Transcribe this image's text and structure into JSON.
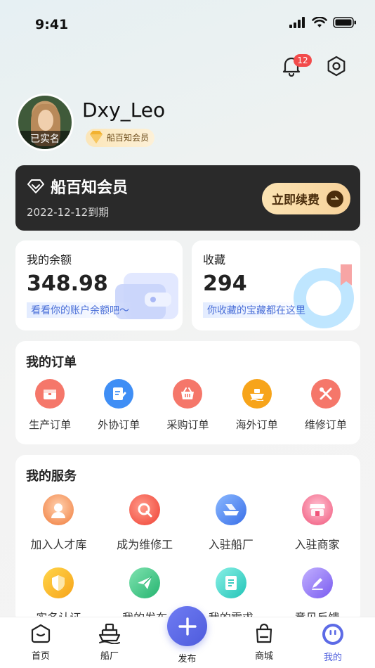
{
  "status_bar": {
    "time": "9:41"
  },
  "header": {
    "notification_count": "12"
  },
  "profile": {
    "username": "Dxy_Leo",
    "verified_label": "已实名",
    "member_badge": "船百知会员"
  },
  "vip_card": {
    "title": "船百知会员",
    "expiry": "2022-12-12到期",
    "renew_label": "立即续费"
  },
  "balance": {
    "title": "我的余额",
    "value": "348.98",
    "hint": "看看你的账户余额吧～"
  },
  "favorites": {
    "title": "收藏",
    "value": "294",
    "hint": "你收藏的宝藏都在这里"
  },
  "orders": {
    "title": "我的订单",
    "items": [
      {
        "label": "生产订单",
        "icon": "box-icon",
        "color": "#f5776a"
      },
      {
        "label": "外协订单",
        "icon": "edit-note-icon",
        "color": "#3f8ef5"
      },
      {
        "label": "采购订单",
        "icon": "basket-icon",
        "color": "#f5776a"
      },
      {
        "label": "海外订单",
        "icon": "ship-icon",
        "color": "#f7a41a"
      },
      {
        "label": "维修订单",
        "icon": "tools-icon",
        "color": "#f5776a"
      }
    ]
  },
  "services": {
    "title": "我的服务",
    "row1": [
      {
        "label": "加入人才库",
        "icon": "person-icon",
        "color": "#f28a4a"
      },
      {
        "label": "成为维修工",
        "icon": "wrench-icon",
        "color": "#f25a4a"
      },
      {
        "label": "入驻船厂",
        "icon": "shipyard-icon",
        "color": "#4a8af2"
      },
      {
        "label": "入驻商家",
        "icon": "shop-icon",
        "color": "#f56c8c"
      }
    ],
    "row2": [
      {
        "label": "实名认证",
        "icon": "shield-icon",
        "color": "#f7b21a"
      },
      {
        "label": "我的发布",
        "icon": "paper-plane-icon",
        "color": "#3cc48a"
      },
      {
        "label": "我的需求",
        "icon": "document-icon",
        "color": "#3ccfc4"
      },
      {
        "label": "意见反馈",
        "icon": "pencil-icon",
        "color": "#8a6cf2"
      }
    ]
  },
  "tabbar": {
    "home": "首页",
    "shipyard": "船厂",
    "publish": "发布",
    "mall": "商城",
    "mine": "我的"
  }
}
